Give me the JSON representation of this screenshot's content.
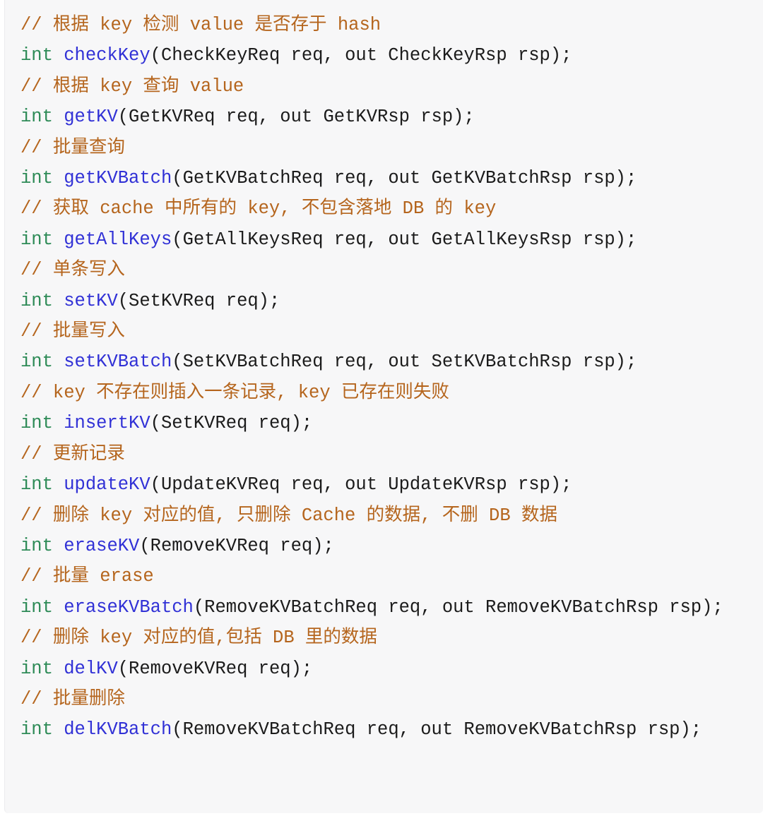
{
  "code_block": {
    "language": "cpp",
    "colors": {
      "background": "#f7f7f8",
      "page_background": "#ffffff",
      "border": "#ececee",
      "comment": "#b5651d",
      "keyword": "#2e8b57",
      "function_name": "#3131d6",
      "plain_text": "#1b1b1b"
    },
    "lines": [
      {
        "index": 1,
        "type": "comment",
        "tokens": [
          {
            "kind": "comment",
            "text": "// 根据 key 检测 value 是否存于 hash"
          }
        ]
      },
      {
        "index": 2,
        "type": "declaration",
        "tokens": [
          {
            "kind": "keyword",
            "text": "int"
          },
          {
            "kind": "plain",
            "text": " "
          },
          {
            "kind": "function",
            "text": "checkKey"
          },
          {
            "kind": "plain",
            "text": "(CheckKeyReq req, out CheckKeyRsp rsp);"
          }
        ]
      },
      {
        "index": 3,
        "type": "comment",
        "tokens": [
          {
            "kind": "comment",
            "text": "// 根据 key 查询 value"
          }
        ]
      },
      {
        "index": 4,
        "type": "declaration",
        "tokens": [
          {
            "kind": "keyword",
            "text": "int"
          },
          {
            "kind": "plain",
            "text": " "
          },
          {
            "kind": "function",
            "text": "getKV"
          },
          {
            "kind": "plain",
            "text": "(GetKVReq req, out GetKVRsp rsp);"
          }
        ]
      },
      {
        "index": 5,
        "type": "comment",
        "tokens": [
          {
            "kind": "comment",
            "text": "// 批量查询"
          }
        ]
      },
      {
        "index": 6,
        "type": "declaration",
        "tokens": [
          {
            "kind": "keyword",
            "text": "int"
          },
          {
            "kind": "plain",
            "text": " "
          },
          {
            "kind": "function",
            "text": "getKVBatch"
          },
          {
            "kind": "plain",
            "text": "(GetKVBatchReq req, out GetKVBatchRsp rsp);"
          }
        ]
      },
      {
        "index": 7,
        "type": "comment",
        "tokens": [
          {
            "kind": "comment",
            "text": "// 获取 cache 中所有的 key, 不包含落地 DB 的 key"
          }
        ]
      },
      {
        "index": 8,
        "type": "declaration",
        "tokens": [
          {
            "kind": "keyword",
            "text": "int"
          },
          {
            "kind": "plain",
            "text": " "
          },
          {
            "kind": "function",
            "text": "getAllKeys"
          },
          {
            "kind": "plain",
            "text": "(GetAllKeysReq req, out GetAllKeysRsp rsp);"
          }
        ]
      },
      {
        "index": 9,
        "type": "comment",
        "tokens": [
          {
            "kind": "comment",
            "text": "// 单条写入"
          }
        ]
      },
      {
        "index": 10,
        "type": "declaration",
        "tokens": [
          {
            "kind": "keyword",
            "text": "int"
          },
          {
            "kind": "plain",
            "text": " "
          },
          {
            "kind": "function",
            "text": "setKV"
          },
          {
            "kind": "plain",
            "text": "(SetKVReq req);"
          }
        ]
      },
      {
        "index": 11,
        "type": "comment",
        "tokens": [
          {
            "kind": "comment",
            "text": "// 批量写入"
          }
        ]
      },
      {
        "index": 12,
        "type": "declaration",
        "tokens": [
          {
            "kind": "keyword",
            "text": "int"
          },
          {
            "kind": "plain",
            "text": " "
          },
          {
            "kind": "function",
            "text": "setKVBatch"
          },
          {
            "kind": "plain",
            "text": "(SetKVBatchReq req, out SetKVBatchRsp rsp);"
          }
        ]
      },
      {
        "index": 13,
        "type": "comment",
        "tokens": [
          {
            "kind": "comment",
            "text": "// key 不存在则插入一条记录, key 已存在则失败"
          }
        ]
      },
      {
        "index": 14,
        "type": "declaration",
        "tokens": [
          {
            "kind": "keyword",
            "text": "int"
          },
          {
            "kind": "plain",
            "text": " "
          },
          {
            "kind": "function",
            "text": "insertKV"
          },
          {
            "kind": "plain",
            "text": "(SetKVReq req);"
          }
        ]
      },
      {
        "index": 15,
        "type": "comment",
        "tokens": [
          {
            "kind": "comment",
            "text": "// 更新记录"
          }
        ]
      },
      {
        "index": 16,
        "type": "declaration",
        "tokens": [
          {
            "kind": "keyword",
            "text": "int"
          },
          {
            "kind": "plain",
            "text": " "
          },
          {
            "kind": "function",
            "text": "updateKV"
          },
          {
            "kind": "plain",
            "text": "(UpdateKVReq req, out UpdateKVRsp rsp);"
          }
        ]
      },
      {
        "index": 17,
        "type": "comment",
        "tokens": [
          {
            "kind": "comment",
            "text": "// 删除 key 对应的值, 只删除 Cache 的数据, 不删 DB 数据"
          }
        ]
      },
      {
        "index": 18,
        "type": "declaration",
        "tokens": [
          {
            "kind": "keyword",
            "text": "int"
          },
          {
            "kind": "plain",
            "text": " "
          },
          {
            "kind": "function",
            "text": "eraseKV"
          },
          {
            "kind": "plain",
            "text": "(RemoveKVReq req);"
          }
        ]
      },
      {
        "index": 19,
        "type": "comment",
        "tokens": [
          {
            "kind": "comment",
            "text": "// 批量 erase"
          }
        ]
      },
      {
        "index": 20,
        "type": "declaration",
        "wrapped": true,
        "tokens": [
          {
            "kind": "keyword",
            "text": "int"
          },
          {
            "kind": "plain",
            "text": " "
          },
          {
            "kind": "function",
            "text": "eraseKVBatch"
          },
          {
            "kind": "plain",
            "text": "(RemoveKVBatchReq req, out RemoveKVBatchRsp rsp);"
          }
        ]
      },
      {
        "index": 21,
        "type": "comment",
        "tokens": [
          {
            "kind": "comment",
            "text": "// 删除 key 对应的值,包括 DB 里的数据"
          }
        ]
      },
      {
        "index": 22,
        "type": "declaration",
        "tokens": [
          {
            "kind": "keyword",
            "text": "int"
          },
          {
            "kind": "plain",
            "text": " "
          },
          {
            "kind": "function",
            "text": "delKV"
          },
          {
            "kind": "plain",
            "text": "(RemoveKVReq req);"
          }
        ]
      },
      {
        "index": 23,
        "type": "comment",
        "tokens": [
          {
            "kind": "comment",
            "text": "// 批量删除"
          }
        ]
      },
      {
        "index": 24,
        "type": "declaration",
        "wrapped": true,
        "tokens": [
          {
            "kind": "keyword",
            "text": "int"
          },
          {
            "kind": "plain",
            "text": " "
          },
          {
            "kind": "function",
            "text": "delKVBatch"
          },
          {
            "kind": "plain",
            "text": "(RemoveKVBatchReq req, out RemoveKVBatchRsp rsp);"
          }
        ]
      }
    ]
  }
}
